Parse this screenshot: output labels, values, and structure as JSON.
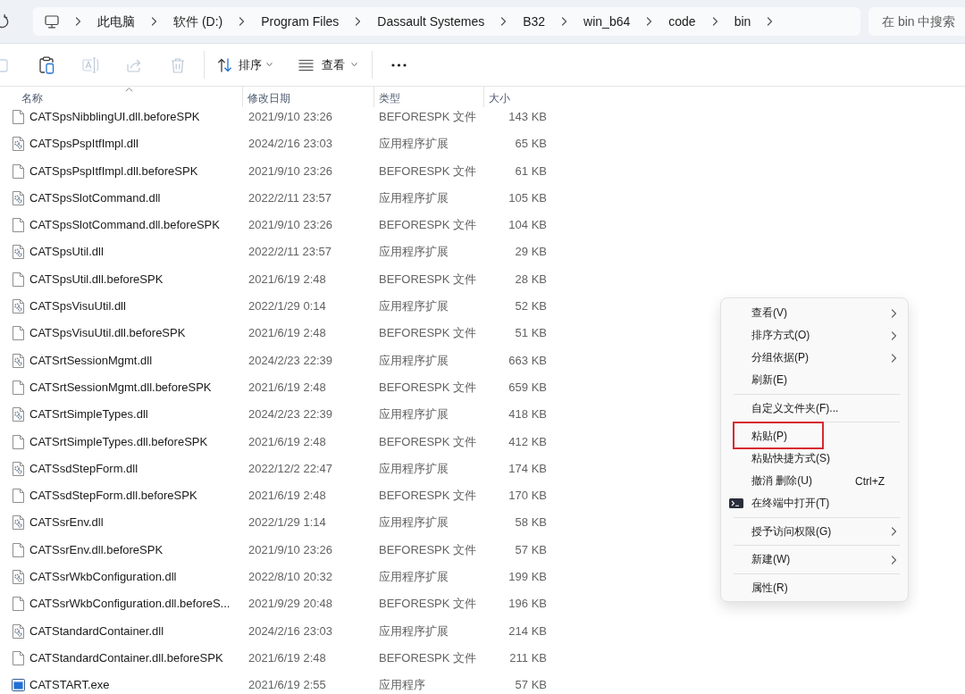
{
  "address_bar": {
    "breadcrumbs": [
      "此电脑",
      "软件 (D:)",
      "Program Files",
      "Dassault Systemes",
      "B32",
      "win_b64",
      "code",
      "bin"
    ]
  },
  "search": {
    "placeholder": "在 bin 中搜索"
  },
  "toolbar": {
    "icon_buttons": [
      {
        "kind": "copy",
        "disabled": true
      },
      {
        "kind": "paste",
        "disabled": false
      },
      {
        "kind": "rename",
        "disabled": true
      },
      {
        "kind": "share",
        "disabled": true
      },
      {
        "kind": "delete",
        "disabled": true
      }
    ],
    "sort_button": {
      "label": "排序"
    },
    "view_button": {
      "label": "查看"
    }
  },
  "table": {
    "columns": [
      {
        "label": "名称",
        "sorted": true
      },
      {
        "label": "修改日期",
        "sorted": false
      },
      {
        "label": "类型",
        "sorted": false
      },
      {
        "label": "大小",
        "sorted": false
      }
    ],
    "rows": [
      {
        "kind": "file",
        "name": "CATSpsNibblingUI.dll.beforeSPK",
        "modified": "2021/9/10 23:26",
        "type": "BEFORESPK 文件",
        "size": "143 KB"
      },
      {
        "kind": "dll",
        "name": "CATSpsPspItfImpl.dll",
        "modified": "2024/2/16 23:03",
        "type": "应用程序扩展",
        "size": "65 KB"
      },
      {
        "kind": "file",
        "name": "CATSpsPspItfImpl.dll.beforeSPK",
        "modified": "2021/9/10 23:26",
        "type": "BEFORESPK 文件",
        "size": "61 KB"
      },
      {
        "kind": "dll",
        "name": "CATSpsSlotCommand.dll",
        "modified": "2022/2/11 23:57",
        "type": "应用程序扩展",
        "size": "105 KB"
      },
      {
        "kind": "file",
        "name": "CATSpsSlotCommand.dll.beforeSPK",
        "modified": "2021/9/10 23:26",
        "type": "BEFORESPK 文件",
        "size": "104 KB"
      },
      {
        "kind": "dll",
        "name": "CATSpsUtil.dll",
        "modified": "2022/2/11 23:57",
        "type": "应用程序扩展",
        "size": "29 KB"
      },
      {
        "kind": "file",
        "name": "CATSpsUtil.dll.beforeSPK",
        "modified": "2021/6/19 2:48",
        "type": "BEFORESPK 文件",
        "size": "28 KB"
      },
      {
        "kind": "dll",
        "name": "CATSpsVisuUtil.dll",
        "modified": "2022/1/29 0:14",
        "type": "应用程序扩展",
        "size": "52 KB"
      },
      {
        "kind": "file",
        "name": "CATSpsVisuUtil.dll.beforeSPK",
        "modified": "2021/6/19 2:48",
        "type": "BEFORESPK 文件",
        "size": "51 KB"
      },
      {
        "kind": "dll",
        "name": "CATSrtSessionMgmt.dll",
        "modified": "2024/2/23 22:39",
        "type": "应用程序扩展",
        "size": "663 KB"
      },
      {
        "kind": "file",
        "name": "CATSrtSessionMgmt.dll.beforeSPK",
        "modified": "2021/6/19 2:48",
        "type": "BEFORESPK 文件",
        "size": "659 KB"
      },
      {
        "kind": "dll",
        "name": "CATSrtSimpleTypes.dll",
        "modified": "2024/2/23 22:39",
        "type": "应用程序扩展",
        "size": "418 KB"
      },
      {
        "kind": "file",
        "name": "CATSrtSimpleTypes.dll.beforeSPK",
        "modified": "2021/6/19 2:48",
        "type": "BEFORESPK 文件",
        "size": "412 KB"
      },
      {
        "kind": "dll",
        "name": "CATSsdStepForm.dll",
        "modified": "2022/12/2 22:47",
        "type": "应用程序扩展",
        "size": "174 KB"
      },
      {
        "kind": "file",
        "name": "CATSsdStepForm.dll.beforeSPK",
        "modified": "2021/6/19 2:48",
        "type": "BEFORESPK 文件",
        "size": "170 KB"
      },
      {
        "kind": "dll",
        "name": "CATSsrEnv.dll",
        "modified": "2022/1/29 1:14",
        "type": "应用程序扩展",
        "size": "58 KB"
      },
      {
        "kind": "file",
        "name": "CATSsrEnv.dll.beforeSPK",
        "modified": "2021/9/10 23:26",
        "type": "BEFORESPK 文件",
        "size": "57 KB"
      },
      {
        "kind": "dll",
        "name": "CATSsrWkbConfiguration.dll",
        "modified": "2022/8/10 20:32",
        "type": "应用程序扩展",
        "size": "199 KB"
      },
      {
        "kind": "file",
        "name": "CATSsrWkbConfiguration.dll.beforeS...",
        "modified": "2021/9/29 20:48",
        "type": "BEFORESPK 文件",
        "size": "196 KB"
      },
      {
        "kind": "dll",
        "name": "CATStandardContainer.dll",
        "modified": "2024/2/16 23:03",
        "type": "应用程序扩展",
        "size": "214 KB"
      },
      {
        "kind": "file",
        "name": "CATStandardContainer.dll.beforeSPK",
        "modified": "2021/6/19 2:48",
        "type": "BEFORESPK 文件",
        "size": "211 KB"
      },
      {
        "kind": "exe",
        "name": "CATSTART.exe",
        "modified": "2021/6/19 2:55",
        "type": "应用程序",
        "size": "57 KB"
      }
    ]
  },
  "context_menu": {
    "groups": [
      {
        "items": [
          {
            "label": "查看(V)",
            "submenu": true,
            "highlighted": false,
            "has_icon": false
          },
          {
            "label": "排序方式(O)",
            "submenu": true,
            "highlighted": false,
            "has_icon": false
          },
          {
            "label": "分组依据(P)",
            "submenu": true,
            "highlighted": false,
            "has_icon": false
          },
          {
            "label": "刷新(E)",
            "submenu": false,
            "highlighted": false,
            "has_icon": false
          }
        ]
      },
      {
        "items": [
          {
            "label": "自定义文件夹(F)...",
            "submenu": false,
            "highlighted": false,
            "has_icon": false
          }
        ]
      },
      {
        "items": [
          {
            "label": "粘贴(P)",
            "submenu": false,
            "highlighted": true,
            "has_icon": false
          },
          {
            "label": "粘贴快捷方式(S)",
            "submenu": false,
            "highlighted": false,
            "has_icon": false
          },
          {
            "label": "撤消 删除(U)",
            "shortcut": "Ctrl+Z",
            "submenu": false,
            "highlighted": false,
            "has_icon": false
          },
          {
            "label": "在终端中打开(T)",
            "submenu": false,
            "highlighted": false,
            "has_icon": true
          }
        ]
      },
      {
        "items": [
          {
            "label": "授予访问权限(G)",
            "submenu": true,
            "highlighted": false,
            "has_icon": false
          }
        ]
      },
      {
        "items": [
          {
            "label": "新建(W)",
            "submenu": true,
            "highlighted": false,
            "has_icon": false
          }
        ]
      },
      {
        "items": [
          {
            "label": "属性(R)",
            "submenu": false,
            "highlighted": false,
            "has_icon": false
          }
        ]
      }
    ]
  }
}
